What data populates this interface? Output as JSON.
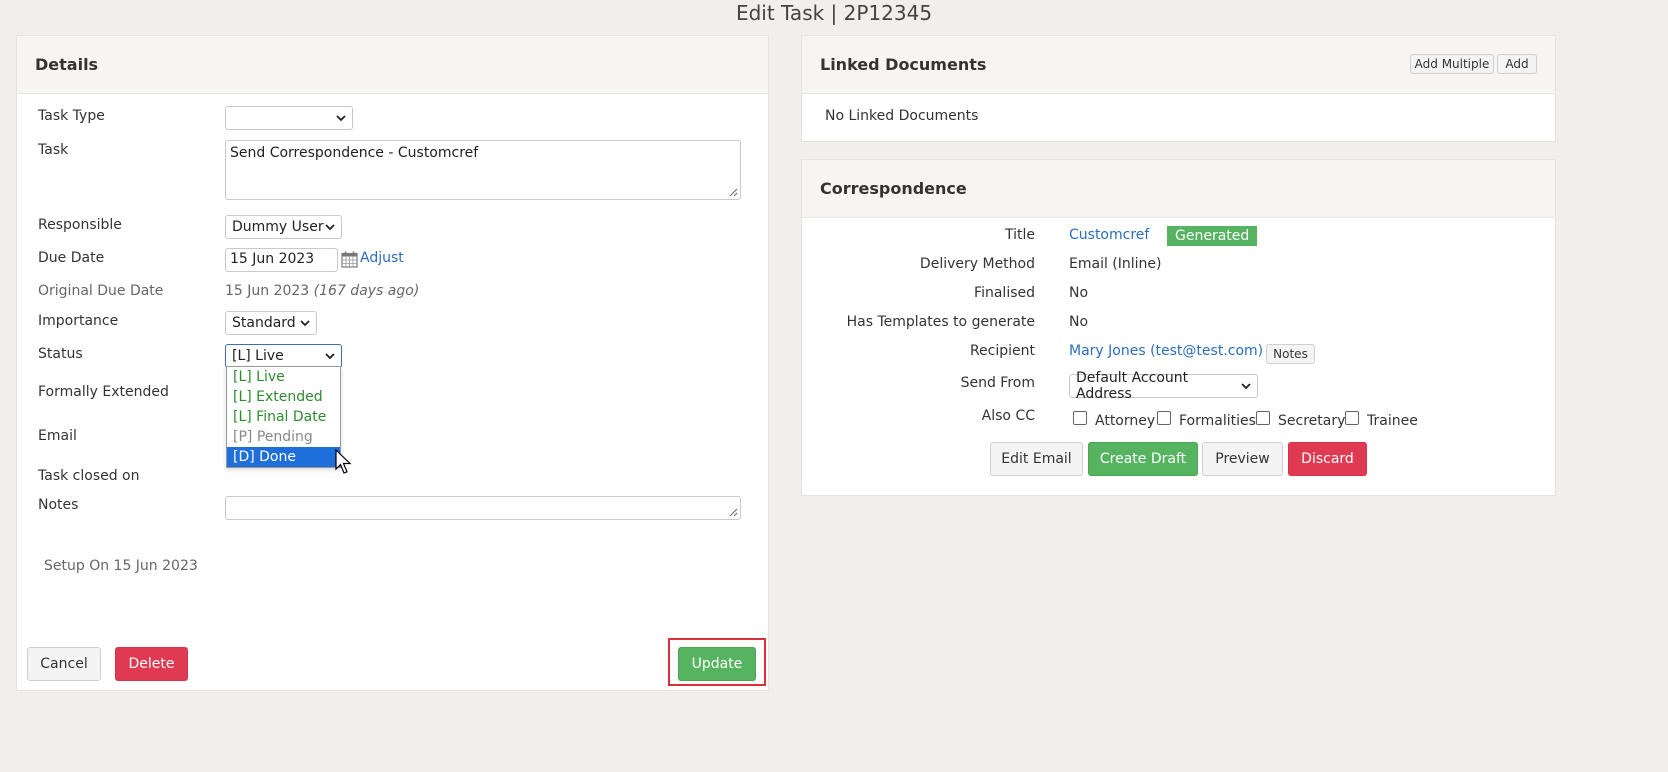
{
  "page": {
    "title": "Edit Task | 2P12345"
  },
  "details": {
    "heading": "Details",
    "labels": {
      "task_type": "Task Type",
      "task": "Task",
      "responsible": "Responsible",
      "due_date": "Due Date",
      "original_due_date": "Original Due Date",
      "importance": "Importance",
      "status": "Status",
      "formally_extended": "Formally Extended",
      "email": "Email",
      "task_closed_on": "Task closed on",
      "notes": "Notes"
    },
    "task_type_value": "",
    "task_value": "Send Correspondence - Customcref",
    "responsible_value": "Dummy User",
    "due_date_value": "15 Jun 2023",
    "adjust_link": "Adjust",
    "original_due_date_value": "15 Jun 2023",
    "original_due_date_note": "(167 days ago)",
    "importance_value": "Standard",
    "status_value": "[L] Live",
    "status_options": [
      {
        "label": "[L] Live",
        "color": "#2e8b2e"
      },
      {
        "label": "[L] Extended",
        "color": "#2e8b2e"
      },
      {
        "label": "[L] Final Date",
        "color": "#2e8b2e"
      },
      {
        "label": "[P] Pending",
        "color": "#888888"
      },
      {
        "label": "[D] Done",
        "color": "#ffffff",
        "selected": true
      }
    ],
    "notes_value": "",
    "setup_on": "Setup On 15 Jun 2023",
    "cancel_label": "Cancel",
    "delete_label": "Delete",
    "update_label": "Update"
  },
  "linked_documents": {
    "heading": "Linked Documents",
    "add_multiple_label": "Add Multiple",
    "add_label": "Add",
    "empty_text": "No Linked Documents"
  },
  "correspondence": {
    "heading": "Correspondence",
    "labels": {
      "title": "Title",
      "delivery_method": "Delivery Method",
      "finalised": "Finalised",
      "has_templates": "Has Templates to generate",
      "recipient": "Recipient",
      "send_from": "Send From",
      "also_cc": "Also CC"
    },
    "title_value": "Customcref",
    "status_badge": "Generated",
    "delivery_method_value": "Email (Inline)",
    "finalised_value": "No",
    "has_templates_value": "No",
    "recipient_value": "Mary Jones (test@test.com)",
    "notes_button": "Notes",
    "send_from_value": "Default Account Address",
    "cc_options": [
      "Attorney",
      "Formalities",
      "Secretary",
      "Trainee"
    ],
    "edit_email_label": "Edit Email",
    "create_draft_label": "Create Draft",
    "preview_label": "Preview",
    "discard_label": "Discard"
  },
  "colors": {
    "accent_green": "#56b35f",
    "danger_red": "#e03a52",
    "link_blue": "#2a6ebb",
    "selected_option": "#1e6fd9",
    "highlight_box": "#d9303a"
  }
}
